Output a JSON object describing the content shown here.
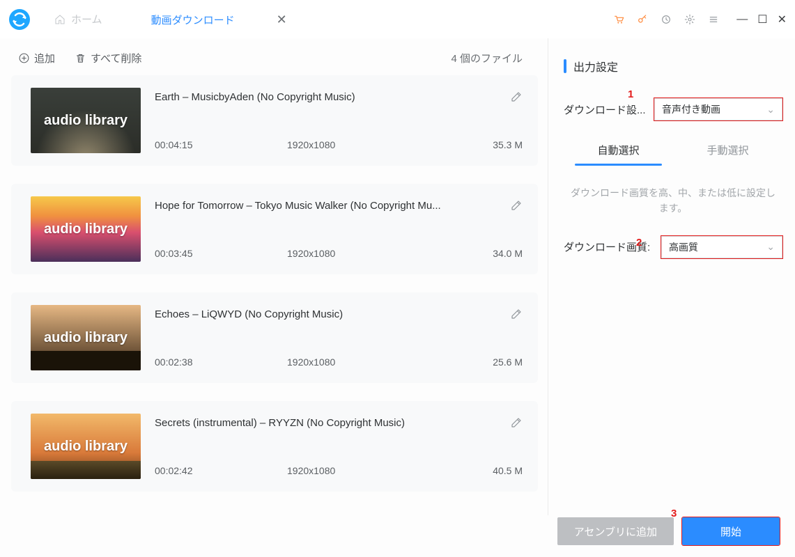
{
  "titlebar": {
    "home_label": "ホーム",
    "download_tab_label": "動画ダウンロード"
  },
  "toolbar": {
    "add_label": "追加",
    "delete_all_label": "すべて削除",
    "file_count_label": "4 個のファイル"
  },
  "items": [
    {
      "title": "Earth – MusicbyAden (No Copyright Music)",
      "duration": "00:04:15",
      "resolution": "1920x1080",
      "size": "35.3 M",
      "thumb_text": "audio library"
    },
    {
      "title": "Hope for Tomorrow – Tokyo Music Walker (No Copyright Mu...",
      "duration": "00:03:45",
      "resolution": "1920x1080",
      "size": "34.0 M",
      "thumb_text": "audio library"
    },
    {
      "title": "Echoes – LiQWYD (No Copyright Music)",
      "duration": "00:02:38",
      "resolution": "1920x1080",
      "size": "25.6 M",
      "thumb_text": "audio library"
    },
    {
      "title": "Secrets (instrumental) – RYYZN (No Copyright Music)",
      "duration": "00:02:42",
      "resolution": "1920x1080",
      "size": "40.5 M",
      "thumb_text": "audio library"
    }
  ],
  "right": {
    "section_title": "出力設定",
    "download_setting_label": "ダウンロード設...",
    "download_setting_value": "音声付き動画",
    "tab_auto": "自動選択",
    "tab_manual": "手動選択",
    "help_text": "ダウンロード画質を高、中、または低に設定します。",
    "quality_label": "ダウンロード画質:",
    "quality_value": "高画質"
  },
  "footer": {
    "add_assembly": "アセンブリに追加",
    "start": "開始"
  },
  "annotations": {
    "a1": "1",
    "a2": "2",
    "a3": "3"
  }
}
